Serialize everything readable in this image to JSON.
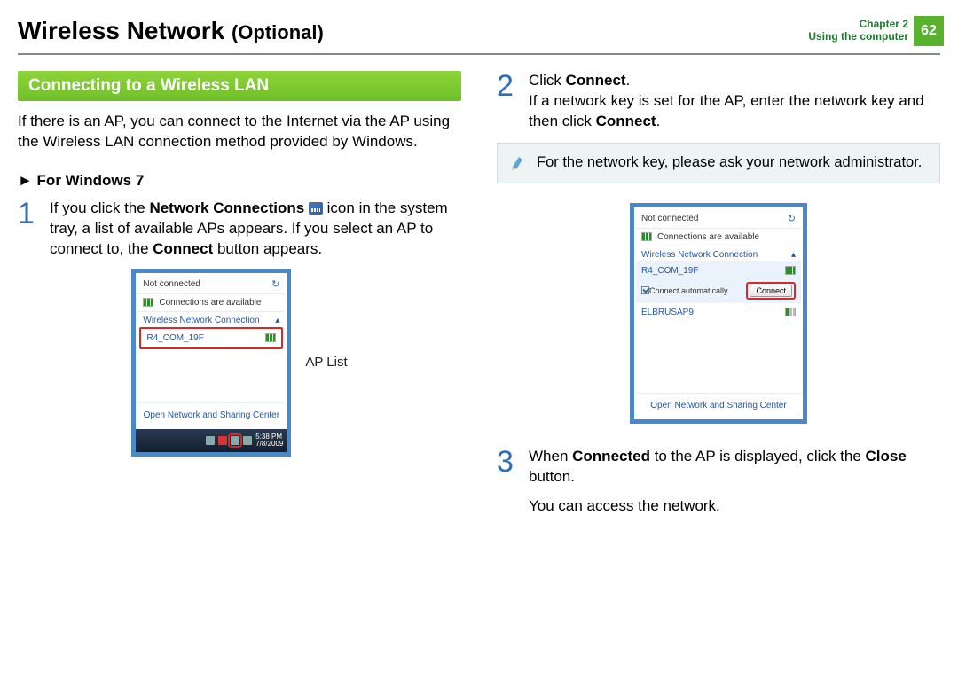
{
  "header": {
    "title_main": "Wireless Network",
    "title_tag": "(Optional)",
    "chapter_line1": "Chapter 2",
    "chapter_line2": "Using the computer",
    "page_number": "62"
  },
  "section_heading": "Connecting to a Wireless LAN",
  "intro": "If there is an AP, you can connect to the Internet via the AP using the Wireless LAN connection method provided by Windows.",
  "sub_heading": "► For Windows 7",
  "step1": {
    "num": "1",
    "t1": "If you click the ",
    "b1": "Network Connections",
    "t2": " icon in the system tray, a list of available APs appears. If you select an AP to connect to, the ",
    "b2": "Connect",
    "t3": " button appears."
  },
  "ap_list_label": "AP List",
  "step2": {
    "num": "2",
    "t1": "Click ",
    "b1": "Connect",
    "t2": ".",
    "line2a": "If a network key is set for the AP, enter the network key and then click ",
    "b2": "Connect",
    "t3": "."
  },
  "note": "For the network key, please ask your network administrator.",
  "step3": {
    "num": "3",
    "t1": "When ",
    "b1": "Connected",
    "t2": " to the AP is displayed, click the ",
    "b2": "Close",
    "t3": " button.",
    "line2": "You can access the network."
  },
  "popup": {
    "not_connected": "Not connected",
    "avail": "Connections are available",
    "wlan_label": "Wireless Network Connection",
    "ap1": "R4_COM_19F",
    "ap2": "ELBRUSAP9",
    "auto": "Connect automatically",
    "connect_btn": "Connect",
    "open_center": "Open Network and Sharing Center",
    "time": "5:38 PM",
    "date": "7/8/2009"
  }
}
